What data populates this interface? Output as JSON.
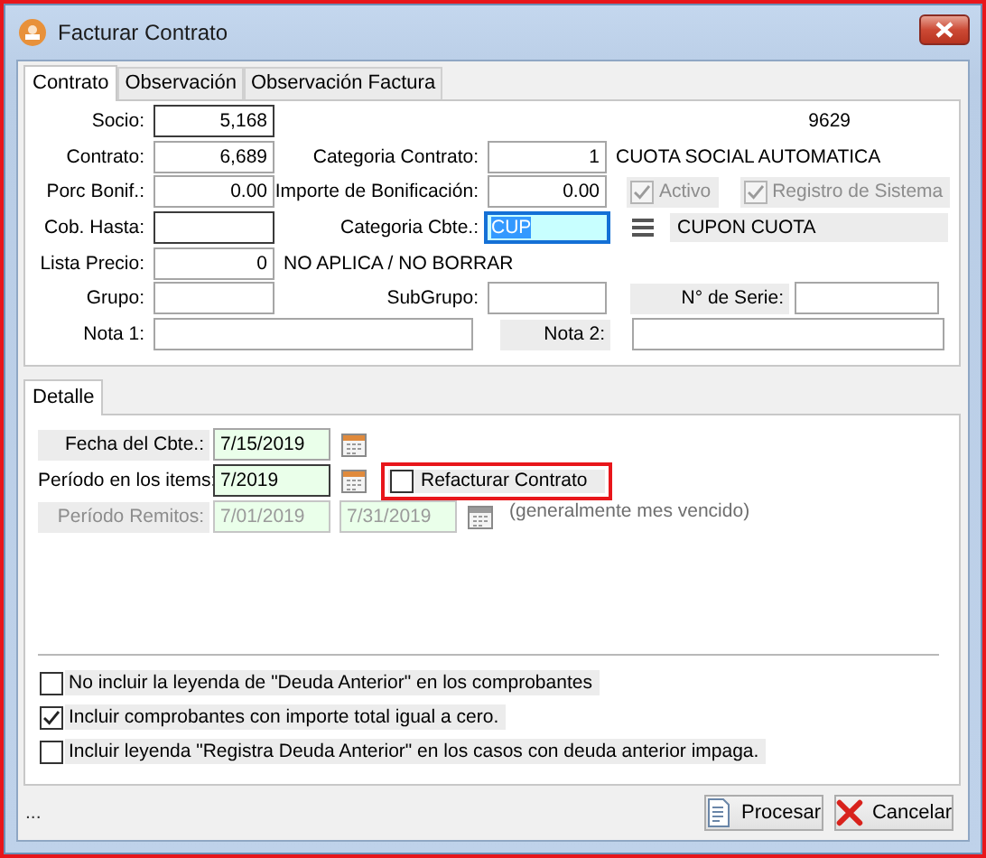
{
  "window": {
    "title": "Facturar Contrato"
  },
  "tabs": [
    {
      "label": "Contrato",
      "selected": true
    },
    {
      "label": "Observación",
      "selected": false
    },
    {
      "label": "Observación Factura",
      "selected": false
    }
  ],
  "socio": {
    "label": "Socio:",
    "value": "5,168"
  },
  "socio_code": "9629",
  "contrato": {
    "label": "Contrato:",
    "value": "6,689"
  },
  "categoria_contrato": {
    "label": "Categoria Contrato:",
    "value": "1",
    "description": "CUOTA SOCIAL AUTOMATICA"
  },
  "porc_bonif": {
    "label": "Porc Bonif.:",
    "value": "0.00"
  },
  "importe_bonificacion": {
    "label": "Importe de Bonificación:",
    "value": "0.00"
  },
  "flags": [
    {
      "label": "Activo",
      "checked": true,
      "disabled": true
    },
    {
      "label": "Registro de Sistema",
      "checked": true,
      "disabled": true
    }
  ],
  "cob_hasta": {
    "label": "Cob. Hasta:"
  },
  "categoria_cbte": {
    "label": "Categoria Cbte.:",
    "value": "CUP",
    "focused": true,
    "description": "CUPON CUOTA"
  },
  "lista_precio": {
    "label": "Lista Precio:",
    "value": "0",
    "description": "NO APLICA / NO BORRAR"
  },
  "grupo": {
    "label": "Grupo:"
  },
  "subgrupo": {
    "label": "SubGrupo:"
  },
  "numero_serie": {
    "label": "N° de Serie:"
  },
  "nota_1": {
    "label": "Nota 1:"
  },
  "nota_2": {
    "label": "Nota 2:"
  },
  "detail_tabs": [
    {
      "label": "Detalle",
      "selected": true
    }
  ],
  "fecha_cbte": {
    "label": "Fecha del Cbte.:",
    "value": "7/15/2019"
  },
  "periodo_items": {
    "label": "Período en los items:",
    "value": "7/2019"
  },
  "refacturar": {
    "label": "Refacturar Contrato",
    "checked": false,
    "highlighted": true
  },
  "periodo_remitos": {
    "label": "Período Remitos:",
    "from": "7/01/2019",
    "to": "7/31/2019",
    "disabled": true,
    "hint": "(generalmente mes vencido)"
  },
  "options": [
    {
      "label": "No incluir la leyenda de \"Deuda Anterior\" en los comprobantes",
      "checked": false
    },
    {
      "label": "Incluir comprobantes con importe total igual a cero.",
      "checked": true
    },
    {
      "label": "Incluir leyenda \"Registra Deuda Anterior\" en los casos con deuda anterior impaga.",
      "checked": false
    }
  ],
  "status": "...",
  "buttons": [
    {
      "label": "Procesar",
      "kind": "process"
    },
    {
      "label": "Cancelar",
      "kind": "cancel"
    }
  ]
}
